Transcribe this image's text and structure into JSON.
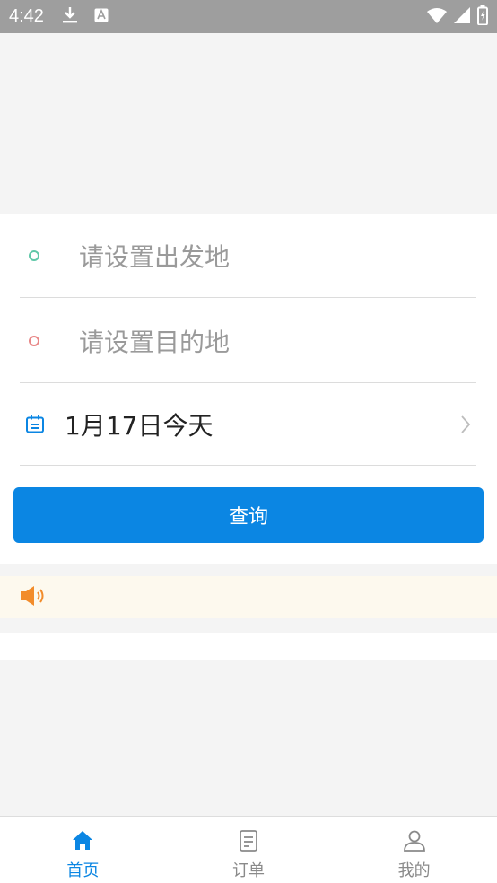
{
  "status_bar": {
    "time": "4:42"
  },
  "form": {
    "origin_placeholder": "请设置出发地",
    "destination_placeholder": "请设置目的地",
    "date_text": "1月17日今天",
    "query_label": "查询"
  },
  "tabs": [
    {
      "label": "首页",
      "icon": "home-icon",
      "active": true
    },
    {
      "label": "订单",
      "icon": "order-icon",
      "active": false
    },
    {
      "label": "我的",
      "icon": "user-icon",
      "active": false
    }
  ],
  "colors": {
    "accent": "#0b86e3",
    "origin_dot": "#5fc7a8",
    "destination_dot": "#e88787",
    "notice_icon": "#f28c2b"
  }
}
